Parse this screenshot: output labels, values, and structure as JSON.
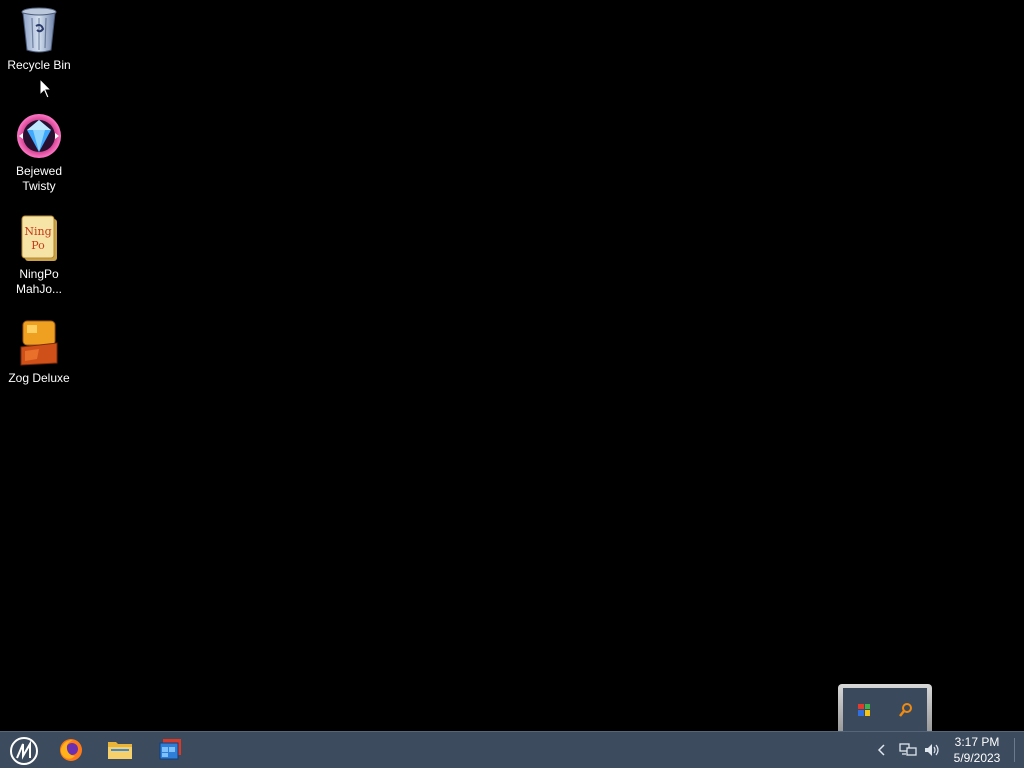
{
  "desktop": {
    "icons": [
      {
        "label": "Recycle Bin",
        "icon": "recycle-bin-icon"
      },
      {
        "label": "Bejewed\nTwisty",
        "icon": "bejeweled-gem-icon"
      },
      {
        "label": "NingPo\nMahJo...",
        "icon": "ningpo-mahjong-icon"
      },
      {
        "label": "Zog Deluxe",
        "icon": "zog-deluxe-icon"
      }
    ]
  },
  "tray_popup": {
    "items": [
      "flag-app-icon",
      "search-tool-icon"
    ]
  },
  "taskbar": {
    "start_icon": "start-logo-icon",
    "pinned": [
      "firefox-icon",
      "file-explorer-icon",
      "windows-app-icon"
    ],
    "tray_icons": [
      "show-hidden-chevron-icon",
      "network-icon",
      "volume-icon"
    ],
    "clock": {
      "time": "3:17 PM",
      "date": "5/9/2023"
    }
  },
  "colors": {
    "desktop_bg": "#000000",
    "taskbar_bg": "#3c4b5e",
    "text": "#ffffff"
  }
}
